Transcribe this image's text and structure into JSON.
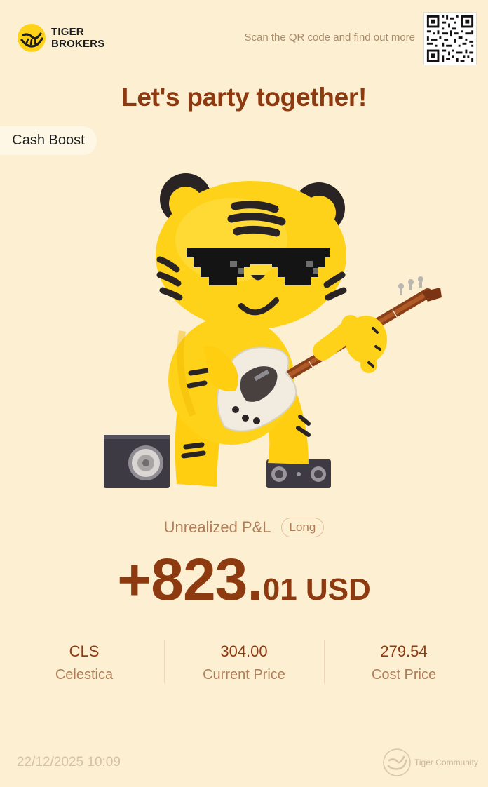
{
  "brand": {
    "line1": "TIGER",
    "line2": "BROKERS"
  },
  "header": {
    "scan_text": "Scan the QR code and find out more"
  },
  "headline": "Let's party together!",
  "tag": "Cash Boost",
  "pnl": {
    "label": "Unrealized P&L",
    "badge": "Long",
    "value_main": "+823.",
    "value_fraction": "01",
    "currency": " USD"
  },
  "stats": [
    {
      "value": "CLS",
      "label": "Celestica"
    },
    {
      "value": "304.00",
      "label": "Current Price"
    },
    {
      "value": "279.54",
      "label": "Cost Price"
    }
  ],
  "footer": {
    "timestamp": "22/12/2025 10:09",
    "community": "Tiger Community"
  },
  "colors": {
    "background": "#FDEFD1",
    "accent": "#8E3A10",
    "muted": "#B07E59",
    "tiger_yellow": "#FFD21A"
  }
}
